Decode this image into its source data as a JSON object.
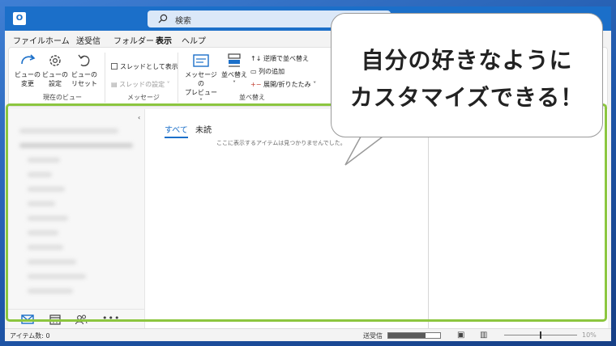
{
  "app": {
    "icon_letter": "O",
    "search_label": "検索"
  },
  "menu": [
    "ファイル",
    "ホーム",
    "送受信",
    "フォルダー",
    "表示",
    "ヘルプ"
  ],
  "menu_active_index": 4,
  "ribbon": {
    "view_change": [
      "ビューの",
      "変更"
    ],
    "view_settings": [
      "ビューの",
      "設定"
    ],
    "view_reset": [
      "ビューの",
      "リセット"
    ],
    "group_current_view": "現在のビュー",
    "thread_show": "スレッドとして表示",
    "thread_settings": "スレッドの設定",
    "group_messages": "メッセージ",
    "message_preview": [
      "メッセージの",
      "プレビュー"
    ],
    "sort": "並べ替え",
    "reverse_sort": "逆順で並べ替え",
    "add_columns": "列の追加",
    "expand_collapse": "展開/折りたたみ",
    "group_arrange": "並べ替え"
  },
  "list": {
    "tab_all": "すべて",
    "tab_unread": "未読",
    "empty_message": "ここに表示するアイテムは見つかりませんでした。"
  },
  "status": {
    "item_count": "アイテム数: 0",
    "send_receive": "送受信",
    "zoom": "10%"
  },
  "callout": {
    "line1": "自分の好きなように",
    "line2": "カスタマイズできる！"
  },
  "colors": {
    "accent": "#1b6fc9",
    "highlight": "#8cc63f"
  }
}
